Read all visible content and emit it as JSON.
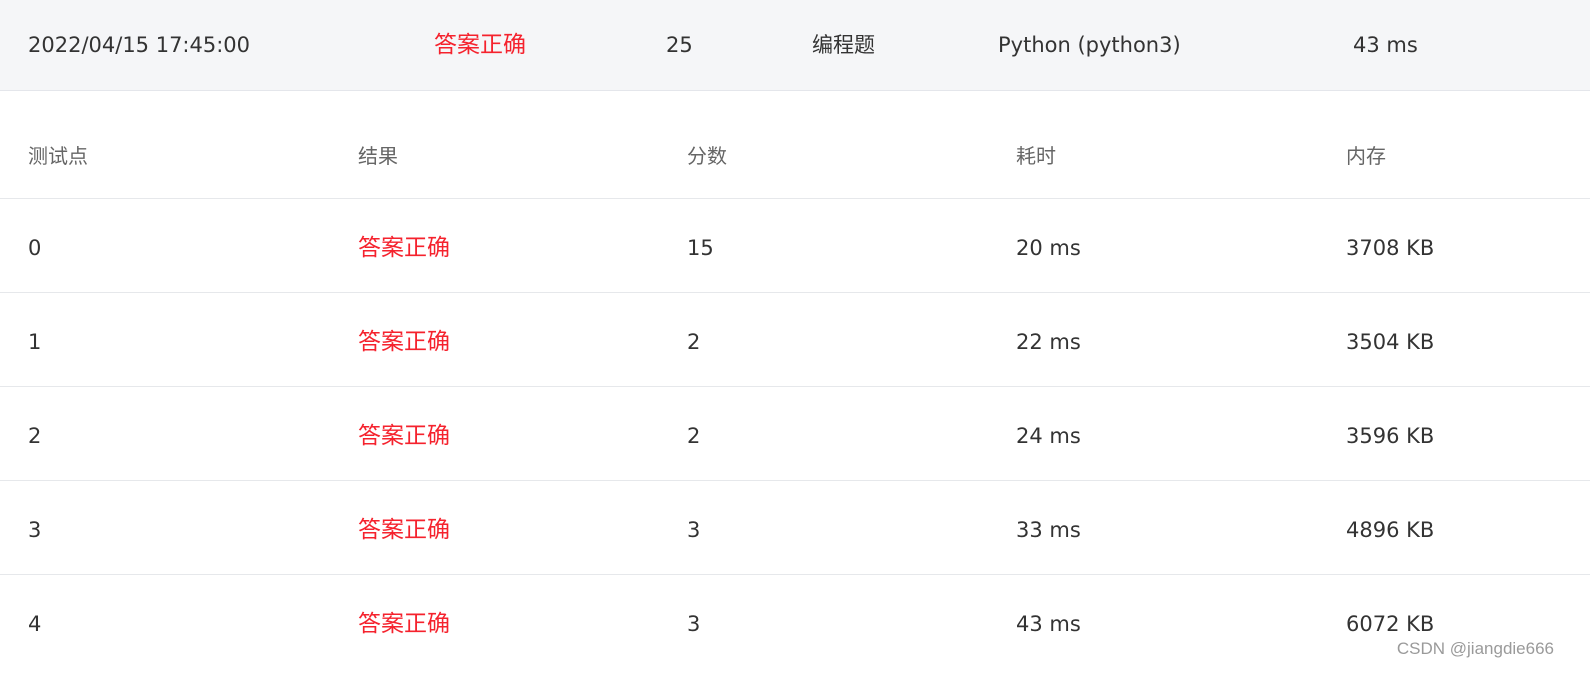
{
  "summary": {
    "submit_time": "2022/04/15 17:45:00",
    "status": "答案正确",
    "score": "25",
    "problem_type": "编程题",
    "language": "Python (python3)",
    "time_cost": "43 ms"
  },
  "table": {
    "headers": [
      "测试点",
      "结果",
      "分数",
      "耗时",
      "内存"
    ],
    "rows": [
      {
        "case": "0",
        "result": "答案正确",
        "score": "15",
        "time": "20 ms",
        "memory": "3708 KB"
      },
      {
        "case": "1",
        "result": "答案正确",
        "score": "2",
        "time": "22 ms",
        "memory": "3504 KB"
      },
      {
        "case": "2",
        "result": "答案正确",
        "score": "2",
        "time": "24 ms",
        "memory": "3596 KB"
      },
      {
        "case": "3",
        "result": "答案正确",
        "score": "3",
        "time": "33 ms",
        "memory": "4896 KB"
      },
      {
        "case": "4",
        "result": "答案正确",
        "score": "3",
        "time": "43 ms",
        "memory": "6072 KB"
      }
    ]
  },
  "watermark": "CSDN @jiangdie666",
  "colors": {
    "accepted": "#f5222d",
    "summary_bg": "#f5f6f8",
    "divider": "#e6e8eb"
  }
}
